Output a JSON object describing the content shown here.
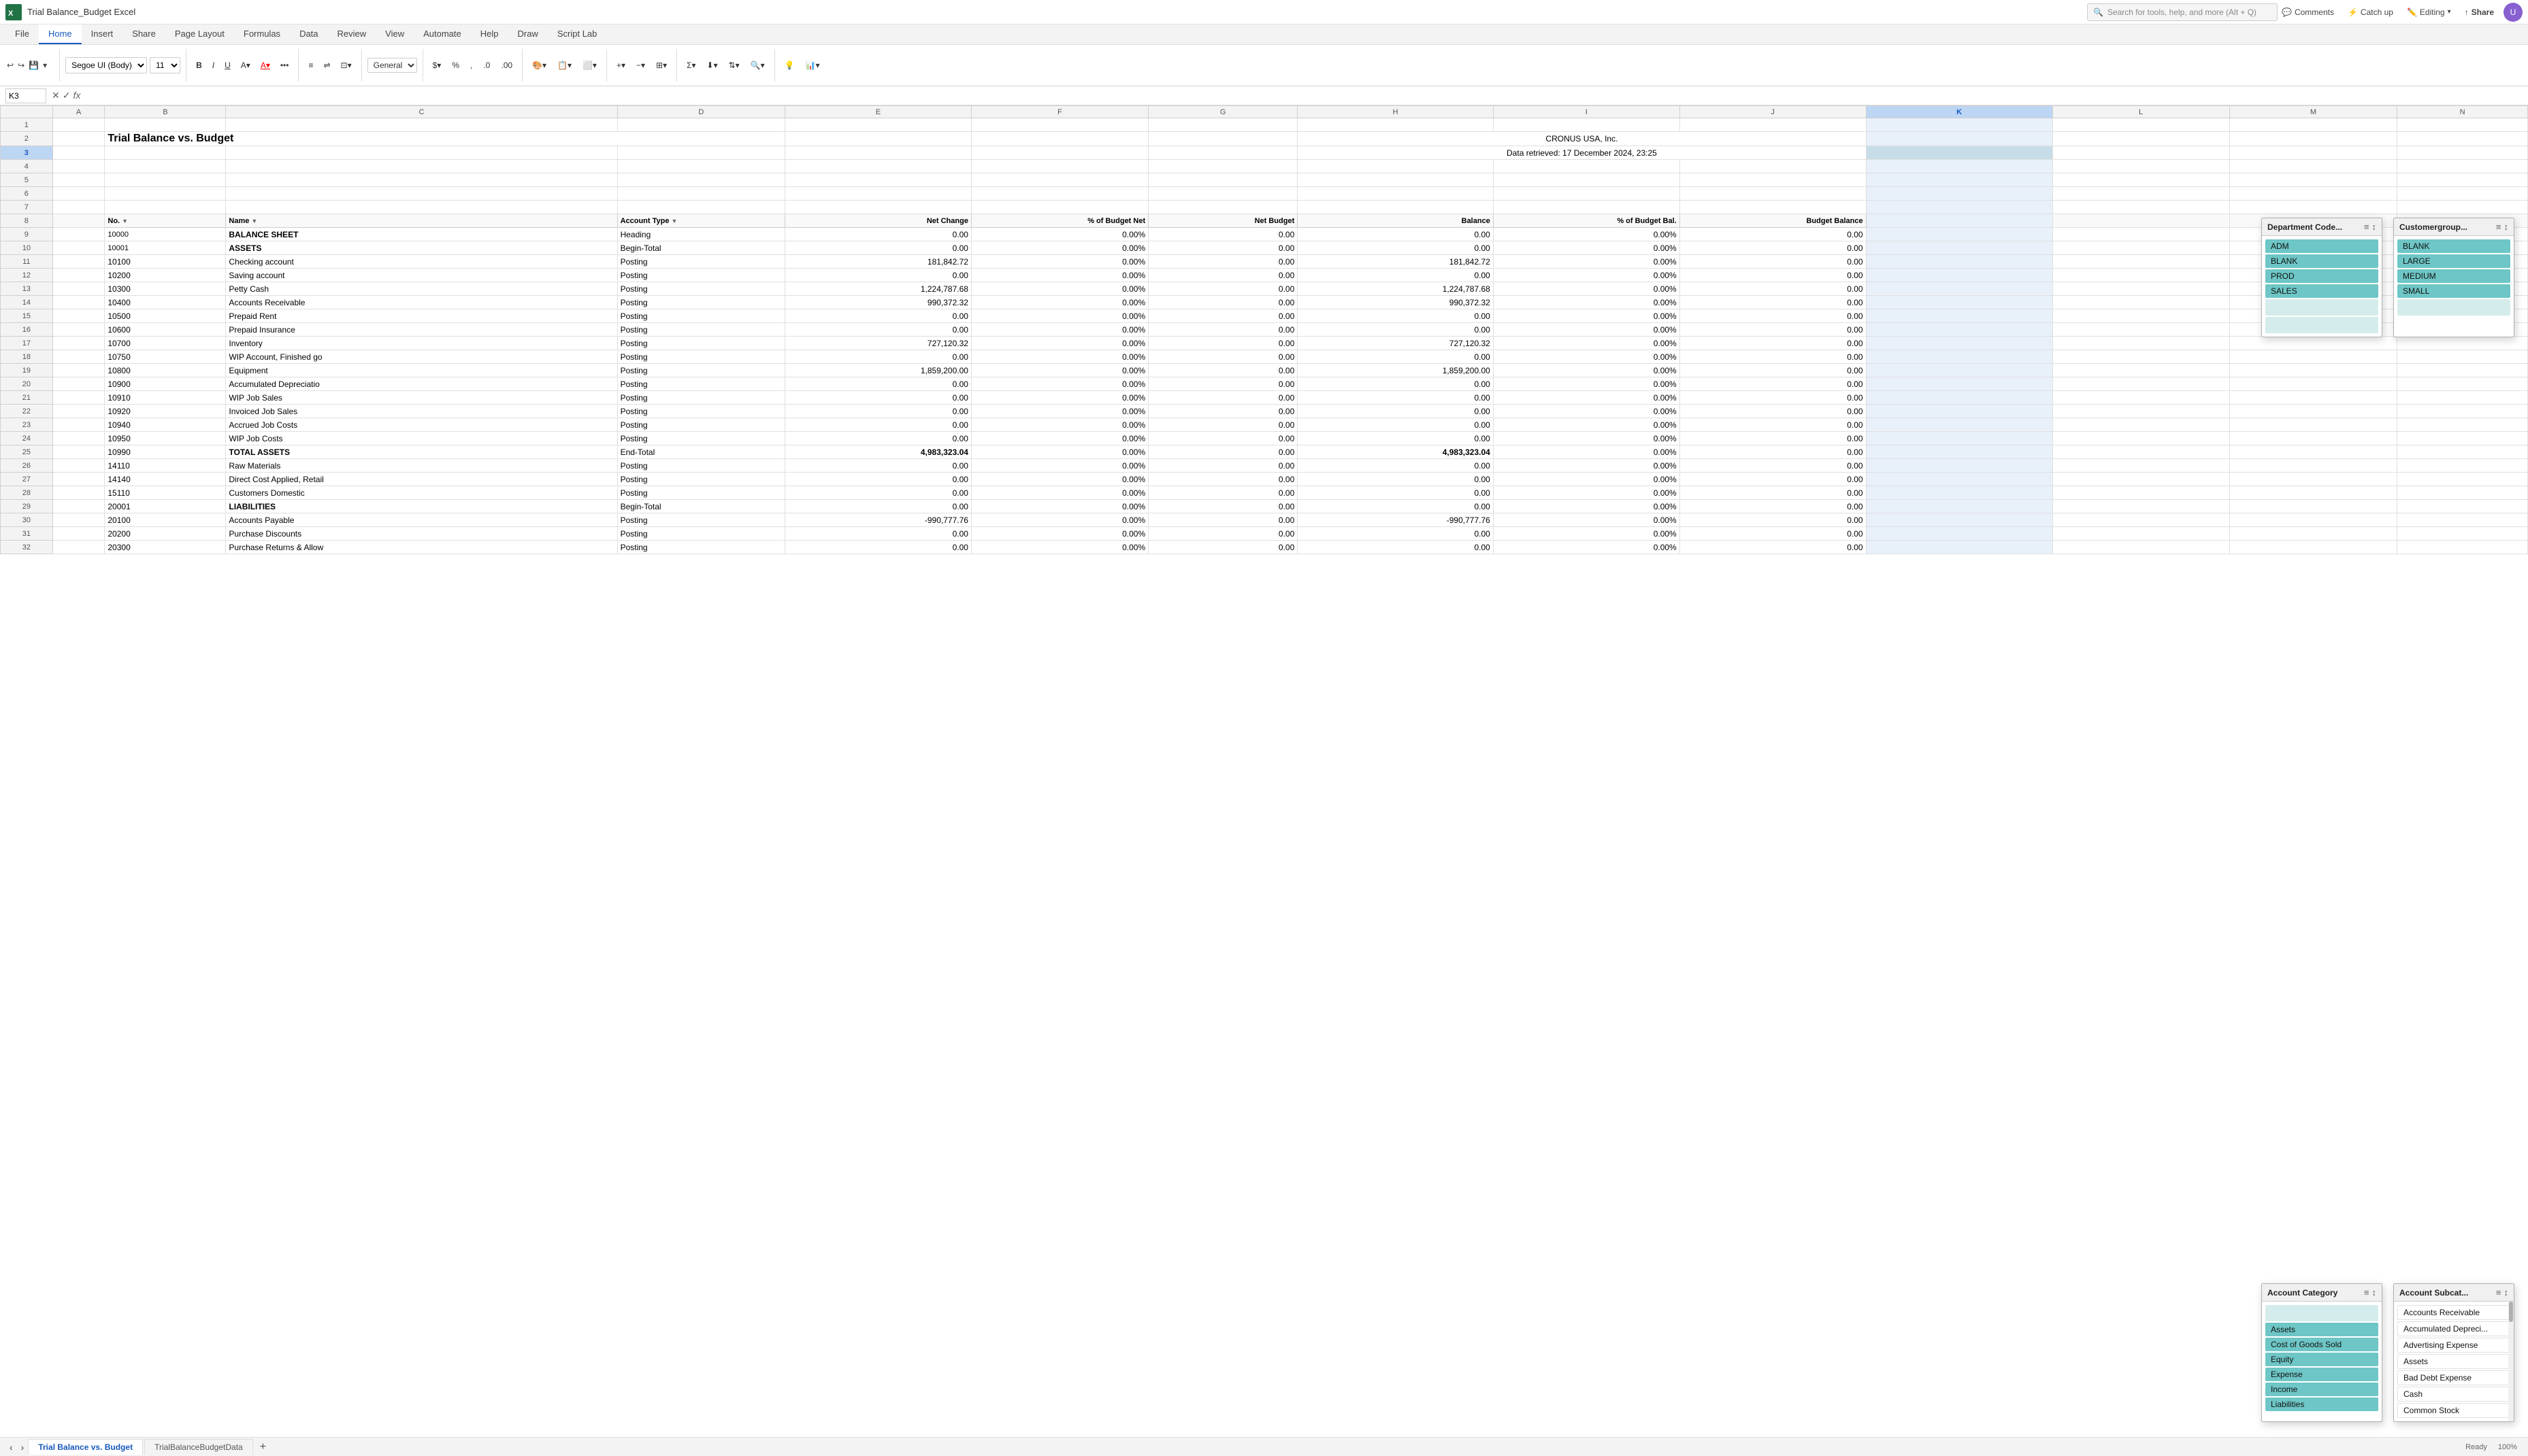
{
  "titleBar": {
    "appName": "Trial Balance_Budget Excel",
    "searchPlaceholder": "Search for tools, help, and more (Alt + Q)"
  },
  "ribbonTabs": [
    "File",
    "Home",
    "Insert",
    "Share",
    "Page Layout",
    "Formulas",
    "Data",
    "Review",
    "View",
    "Automate",
    "Help",
    "Draw",
    "Script Lab"
  ],
  "activeTab": "Home",
  "fontFamily": "Segoe UI (Body)",
  "fontSize": "11",
  "cellRef": "K3",
  "headerActions": {
    "comments": "Comments",
    "catchup": "Catch up",
    "editing": "Editing",
    "share": "Share"
  },
  "spreadsheetTitle": "Trial Balance vs. Budget",
  "companyName": "CRONUS USA, Inc.",
  "dataRetrieved": "Data retrieved: 17 December 2024, 23:25",
  "columns": [
    "No.",
    "Name",
    "Account Type",
    "Net Change",
    "% of Budget Net",
    "Net Budget",
    "Balance",
    "% of Budget Bal.",
    "Budget Balance"
  ],
  "rows": [
    {
      "num": 8,
      "no": "No.",
      "name": "Name",
      "type": "Account Type",
      "netChange": "Net Change",
      "budgetPct": "% of Budget Net",
      "netBudget": "Net Budget",
      "balance": "Balance",
      "budgetBalPct": "% of Budget Bal.",
      "budgetBal": "Budget Balance",
      "isHeader": true
    },
    {
      "num": 9,
      "no": "10000",
      "name": "BALANCE SHEET",
      "type": "Heading",
      "netChange": "0.00",
      "budgetPct": "0.00%",
      "netBudget": "0.00",
      "balance": "0.00",
      "budgetBalPct": "0.00%",
      "budgetBal": "0.00"
    },
    {
      "num": 10,
      "no": "10001",
      "name": "ASSETS",
      "type": "Begin-Total",
      "netChange": "0.00",
      "budgetPct": "0.00%",
      "netBudget": "0.00",
      "balance": "0.00",
      "budgetBalPct": "0.00%",
      "budgetBal": "0.00"
    },
    {
      "num": 11,
      "no": "10100",
      "name": "Checking account",
      "type": "Posting",
      "netChange": "181,842.72",
      "budgetPct": "0.00%",
      "netBudget": "0.00",
      "balance": "181,842.72",
      "budgetBalPct": "0.00%",
      "budgetBal": "0.00"
    },
    {
      "num": 12,
      "no": "10200",
      "name": "Saving account",
      "type": "Posting",
      "netChange": "0.00",
      "budgetPct": "0.00%",
      "netBudget": "0.00",
      "balance": "0.00",
      "budgetBalPct": "0.00%",
      "budgetBal": "0.00"
    },
    {
      "num": 13,
      "no": "10300",
      "name": "Petty Cash",
      "type": "Posting",
      "netChange": "1,224,787.68",
      "budgetPct": "0.00%",
      "netBudget": "0.00",
      "balance": "1,224,787.68",
      "budgetBalPct": "0.00%",
      "budgetBal": "0.00"
    },
    {
      "num": 14,
      "no": "10400",
      "name": "Accounts Receivable",
      "type": "Posting",
      "netChange": "990,372.32",
      "budgetPct": "0.00%",
      "netBudget": "0.00",
      "balance": "990,372.32",
      "budgetBalPct": "0.00%",
      "budgetBal": "0.00"
    },
    {
      "num": 15,
      "no": "10500",
      "name": "Prepaid Rent",
      "type": "Posting",
      "netChange": "0.00",
      "budgetPct": "0.00%",
      "netBudget": "0.00",
      "balance": "0.00",
      "budgetBalPct": "0.00%",
      "budgetBal": "0.00"
    },
    {
      "num": 16,
      "no": "10600",
      "name": "Prepaid Insurance",
      "type": "Posting",
      "netChange": "0.00",
      "budgetPct": "0.00%",
      "netBudget": "0.00",
      "balance": "0.00",
      "budgetBalPct": "0.00%",
      "budgetBal": "0.00"
    },
    {
      "num": 17,
      "no": "10700",
      "name": "Inventory",
      "type": "Posting",
      "netChange": "727,120.32",
      "budgetPct": "0.00%",
      "netBudget": "0.00",
      "balance": "727,120.32",
      "budgetBalPct": "0.00%",
      "budgetBal": "0.00"
    },
    {
      "num": 18,
      "no": "10750",
      "name": "WIP Account, Finished go",
      "type": "Posting",
      "netChange": "0.00",
      "budgetPct": "0.00%",
      "netBudget": "0.00",
      "balance": "0.00",
      "budgetBalPct": "0.00%",
      "budgetBal": "0.00"
    },
    {
      "num": 19,
      "no": "10800",
      "name": "Equipment",
      "type": "Posting",
      "netChange": "1,859,200.00",
      "budgetPct": "0.00%",
      "netBudget": "0.00",
      "balance": "1,859,200.00",
      "budgetBalPct": "0.00%",
      "budgetBal": "0.00"
    },
    {
      "num": 20,
      "no": "10900",
      "name": "Accumulated Depreciatio",
      "type": "Posting",
      "netChange": "0.00",
      "budgetPct": "0.00%",
      "netBudget": "0.00",
      "balance": "0.00",
      "budgetBalPct": "0.00%",
      "budgetBal": "0.00"
    },
    {
      "num": 21,
      "no": "10910",
      "name": "WIP Job Sales",
      "type": "Posting",
      "netChange": "0.00",
      "budgetPct": "0.00%",
      "netBudget": "0.00",
      "balance": "0.00",
      "budgetBalPct": "0.00%",
      "budgetBal": "0.00"
    },
    {
      "num": 22,
      "no": "10920",
      "name": "Invoiced Job Sales",
      "type": "Posting",
      "netChange": "0.00",
      "budgetPct": "0.00%",
      "netBudget": "0.00",
      "balance": "0.00",
      "budgetBalPct": "0.00%",
      "budgetBal": "0.00"
    },
    {
      "num": 23,
      "no": "10940",
      "name": "Accrued Job Costs",
      "type": "Posting",
      "netChange": "0.00",
      "budgetPct": "0.00%",
      "netBudget": "0.00",
      "balance": "0.00",
      "budgetBalPct": "0.00%",
      "budgetBal": "0.00"
    },
    {
      "num": 24,
      "no": "10950",
      "name": "WIP Job Costs",
      "type": "Posting",
      "netChange": "0.00",
      "budgetPct": "0.00%",
      "netBudget": "0.00",
      "balance": "0.00",
      "budgetBalPct": "0.00%",
      "budgetBal": "0.00"
    },
    {
      "num": 25,
      "no": "10990",
      "name": "TOTAL ASSETS",
      "type": "End-Total",
      "netChange": "4,983,323.04",
      "budgetPct": "0.00%",
      "netBudget": "0.00",
      "balance": "4,983,323.04",
      "budgetBalPct": "0.00%",
      "budgetBal": "0.00"
    },
    {
      "num": 26,
      "no": "14110",
      "name": "Raw Materials",
      "type": "Posting",
      "netChange": "0.00",
      "budgetPct": "0.00%",
      "netBudget": "0.00",
      "balance": "0.00",
      "budgetBalPct": "0.00%",
      "budgetBal": "0.00"
    },
    {
      "num": 27,
      "no": "14140",
      "name": "Direct Cost Applied, Retail",
      "type": "Posting",
      "netChange": "0.00",
      "budgetPct": "0.00%",
      "netBudget": "0.00",
      "balance": "0.00",
      "budgetBalPct": "0.00%",
      "budgetBal": "0.00"
    },
    {
      "num": 28,
      "no": "15110",
      "name": "Customers Domestic",
      "type": "Posting",
      "netChange": "0.00",
      "budgetPct": "0.00%",
      "netBudget": "0.00",
      "balance": "0.00",
      "budgetBalPct": "0.00%",
      "budgetBal": "0.00"
    },
    {
      "num": 29,
      "no": "20001",
      "name": "LIABILITIES",
      "type": "Begin-Total",
      "netChange": "0.00",
      "budgetPct": "0.00%",
      "netBudget": "0.00",
      "balance": "0.00",
      "budgetBalPct": "0.00%",
      "budgetBal": "0.00"
    },
    {
      "num": 30,
      "no": "20100",
      "name": "Accounts Payable",
      "type": "Posting",
      "netChange": "-990,777.76",
      "budgetPct": "0.00%",
      "netBudget": "0.00",
      "balance": "-990,777.76",
      "budgetBalPct": "0.00%",
      "budgetBal": "0.00"
    },
    {
      "num": 31,
      "no": "20200",
      "name": "Purchase Discounts",
      "type": "Posting",
      "netChange": "0.00",
      "budgetPct": "0.00%",
      "netBudget": "0.00",
      "balance": "0.00",
      "budgetBalPct": "0.00%",
      "budgetBal": "0.00"
    },
    {
      "num": 32,
      "no": "20300",
      "name": "Purchase Returns & Allow",
      "type": "Posting",
      "netChange": "0.00",
      "budgetPct": "0.00%",
      "netBudget": "0.00",
      "balance": "0.00",
      "budgetBalPct": "0.00%",
      "budgetBal": "0.00"
    }
  ],
  "filterPanels": {
    "departmentCode": {
      "title": "Department Code...",
      "items": [
        "ADM",
        "BLANK",
        "PROD",
        "SALES",
        "",
        ""
      ]
    },
    "customergroup": {
      "title": "Customergroup...",
      "items": [
        "BLANK",
        "LARGE",
        "MEDIUM",
        "SMALL",
        ""
      ]
    },
    "accountCategory": {
      "title": "Account Category",
      "items": [
        "",
        "Assets",
        "Cost of Goods Sold",
        "Equity",
        "Expense",
        "Income",
        "Liabilities"
      ]
    },
    "accountSubcat": {
      "title": "Account Subcat...",
      "items": [
        "Accounts Receivable",
        "Accumulated Depreci...",
        "Advertising Expense",
        "Assets",
        "Bad Debt Expense",
        "Cash",
        "Common Stock"
      ]
    }
  },
  "sheetTabs": [
    "Trial Balance vs. Budget",
    "TrialBalanceBudgetData"
  ],
  "activeSheetTab": "Trial Balance vs. Budget",
  "colLetters": [
    "",
    "A",
    "B",
    "C",
    "D",
    "E",
    "F",
    "G",
    "H",
    "I",
    "J",
    "K",
    "L",
    "M",
    "N"
  ]
}
